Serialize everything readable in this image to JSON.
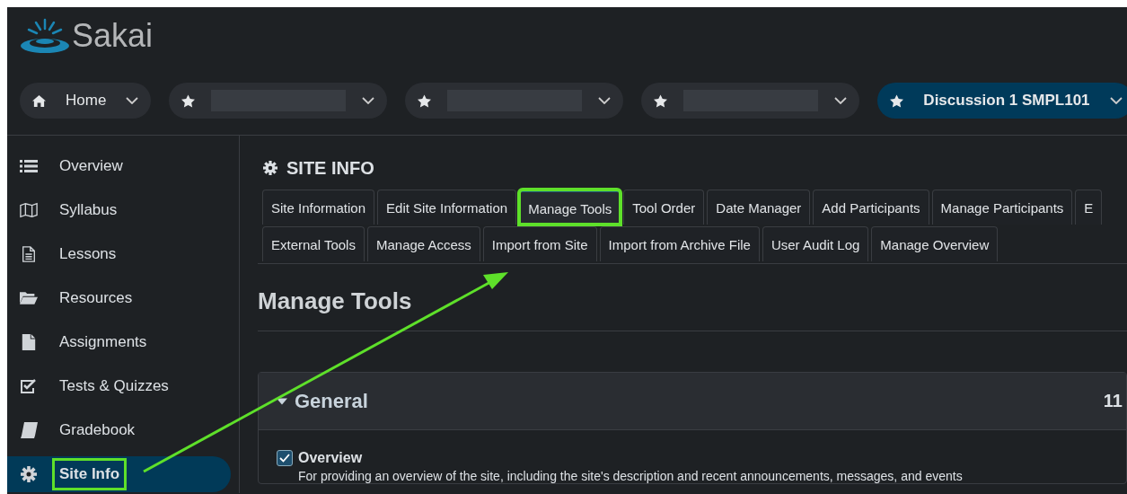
{
  "logo": {
    "text": "Sakai"
  },
  "site_nav": [
    {
      "kind": "home",
      "label": "Home",
      "selected": false
    },
    {
      "kind": "site",
      "selected": false
    },
    {
      "kind": "site",
      "selected": false
    },
    {
      "kind": "site",
      "selected": false
    },
    {
      "kind": "site",
      "label": "Discussion 1 SMPL101",
      "selected": true
    }
  ],
  "sidebar": {
    "items": [
      {
        "label": "Overview",
        "selected": false,
        "highlighted": false
      },
      {
        "label": "Syllabus",
        "selected": false,
        "highlighted": false
      },
      {
        "label": "Lessons",
        "selected": false,
        "highlighted": false
      },
      {
        "label": "Resources",
        "selected": false,
        "highlighted": false
      },
      {
        "label": "Assignments",
        "selected": false,
        "highlighted": false
      },
      {
        "label": "Tests & Quizzes",
        "selected": false,
        "highlighted": false
      },
      {
        "label": "Gradebook",
        "selected": false,
        "highlighted": false
      },
      {
        "label": "Site Info",
        "selected": true,
        "highlighted": true
      }
    ]
  },
  "tool_title": "SITE INFO",
  "tab_rows": [
    [
      {
        "label": "Site Information",
        "selected": false,
        "highlighted": false
      },
      {
        "label": "Edit Site Information",
        "selected": false,
        "highlighted": false
      },
      {
        "label": "Manage Tools",
        "selected": true,
        "highlighted": true
      },
      {
        "label": "Tool Order",
        "selected": false,
        "highlighted": false
      },
      {
        "label": "Date Manager",
        "selected": false,
        "highlighted": false
      },
      {
        "label": "Add Participants",
        "selected": false,
        "highlighted": false
      },
      {
        "label": "Manage Participants",
        "selected": false,
        "highlighted": false
      },
      {
        "label": "E",
        "selected": false,
        "highlighted": false
      }
    ],
    [
      {
        "label": "External Tools",
        "selected": false,
        "highlighted": false
      },
      {
        "label": "Manage Access",
        "selected": false,
        "highlighted": false
      },
      {
        "label": "Import from Site",
        "selected": false,
        "highlighted": false
      },
      {
        "label": "Import from Archive File",
        "selected": false,
        "highlighted": false
      },
      {
        "label": "User Audit Log",
        "selected": false,
        "highlighted": false
      },
      {
        "label": "Manage Overview",
        "selected": false,
        "highlighted": false
      }
    ]
  ],
  "page_heading": "Manage Tools",
  "section": {
    "title": "General",
    "expanded": true,
    "count": "11",
    "tools": [
      {
        "name": "Overview",
        "checked": true,
        "description": "For providing an overview of the site, including the site's description and recent announcements, messages, and events"
      }
    ]
  }
}
